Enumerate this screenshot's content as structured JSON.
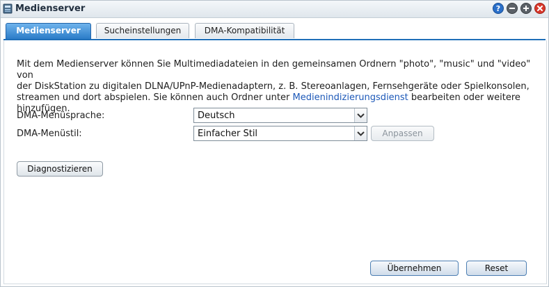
{
  "window": {
    "title": "Medienserver"
  },
  "tabs": [
    {
      "label": "Medienserver",
      "active": true
    },
    {
      "label": "Sucheinstellungen",
      "active": false
    },
    {
      "label": "DMA-Kompatibilität",
      "active": false
    }
  ],
  "description": {
    "line1": "Mit dem Medienserver können Sie Multimediadateien in den gemeinsamen Ordnern \"photo\", \"music\" und \"video\" von",
    "line2": "der DiskStation zu digitalen DLNA/UPnP-Medienadaptern, z. B. Stereoanlagen, Fernsehgeräte oder Spielkonsolen,",
    "line3_before": "streamen und dort abspielen. Sie können auch Ordner unter ",
    "link": "Medienindizierungsdienst",
    "line3_after": " bearbeiten oder weitere",
    "line4": "hinzufügen."
  },
  "form": {
    "menu_language_label": "DMA-Menüsprache:",
    "menu_language_value": "Deutsch",
    "menu_style_label": "DMA-Menüstil:",
    "menu_style_value": "Einfacher Stil",
    "customize_button": "Anpassen"
  },
  "buttons": {
    "diagnose": "Diagnostizieren",
    "apply": "Übernehmen",
    "reset": "Reset"
  },
  "colors": {
    "accent": "#2b7cc8",
    "link": "#1c58b8",
    "help": "#2a6fc9",
    "close": "#d8382c"
  }
}
